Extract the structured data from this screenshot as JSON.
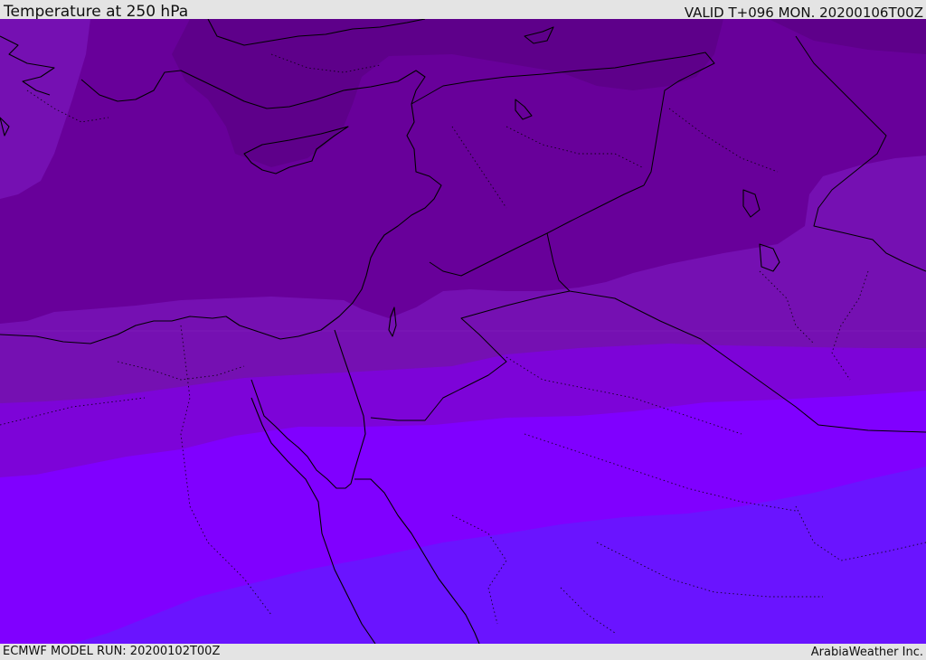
{
  "header": {
    "title": "Temperature at 250 hPa",
    "valid": "VALID T+096 MON. 20200106T00Z"
  },
  "footer": {
    "model_run": "ECMWF MODEL RUN: 20200102T00Z",
    "credit": "ArabiaWeather Inc."
  },
  "map": {
    "field": "temperature",
    "level": "250 hPa",
    "legend_visible": false,
    "band_colors": [
      "#5e008a",
      "#68009a",
      "#7510b2",
      "#7d04d8",
      "#8000ff",
      "#6a14ff"
    ],
    "coastline_color": "#000000",
    "border_style": "dotted"
  }
}
